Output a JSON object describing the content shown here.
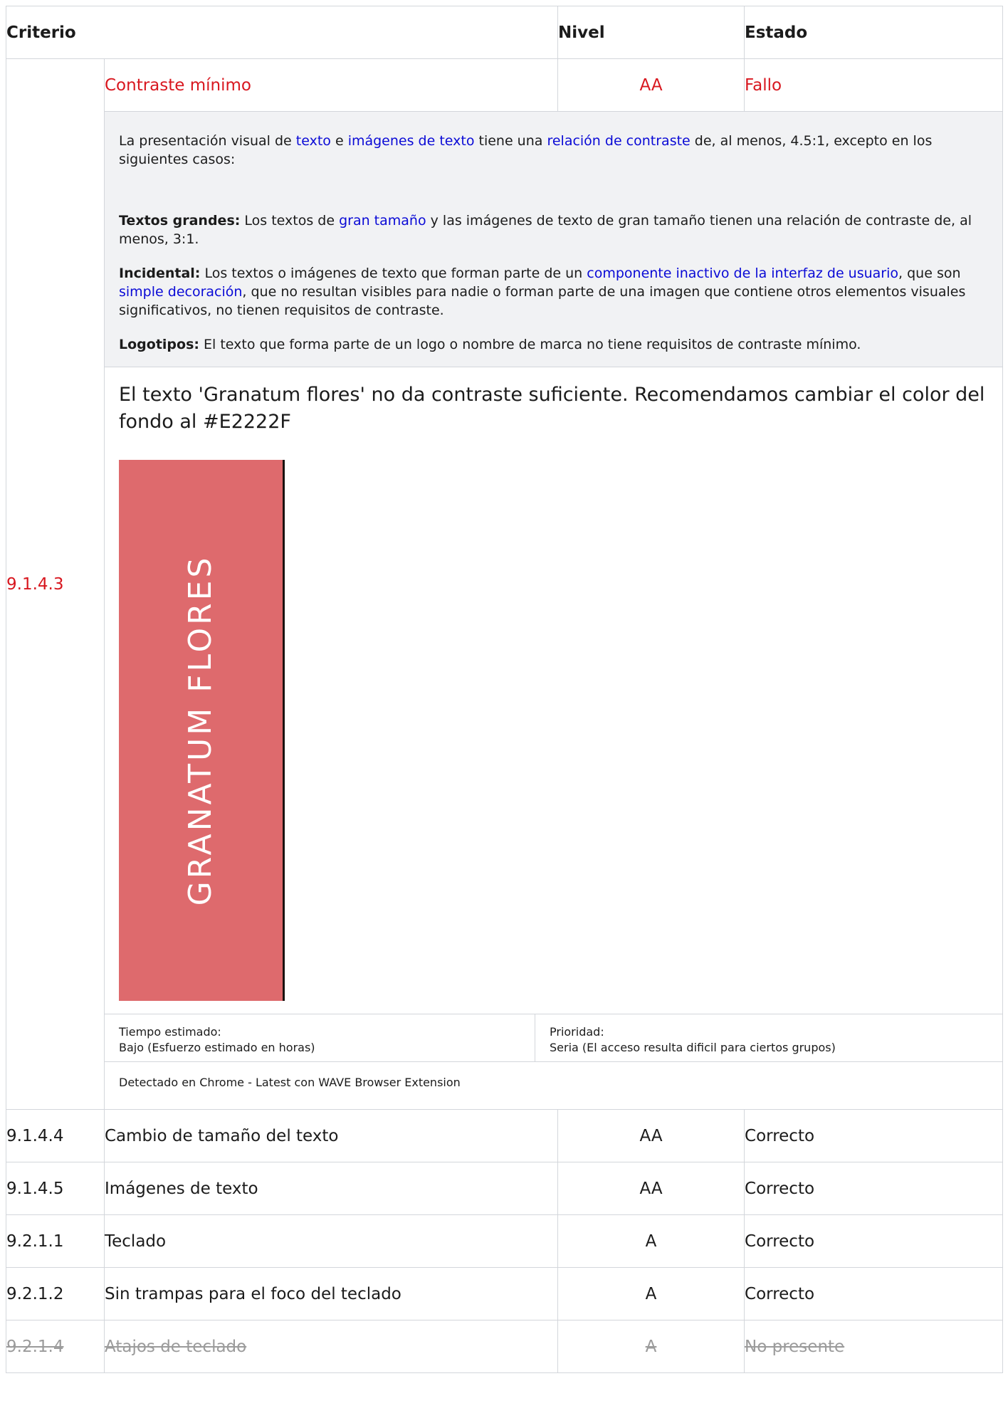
{
  "header": {
    "criterion": "Criterio",
    "level": "Nivel",
    "state": "Estado"
  },
  "failing": {
    "code": "9.1.4.3",
    "name": "Contraste mínimo",
    "level": "AA",
    "state": "Fallo",
    "description": {
      "p1_a": "La presentación visual de ",
      "p1_link1": "texto",
      "p1_b": " e ",
      "p1_link2": "imágenes de texto",
      "p1_c": " tiene una ",
      "p1_link3": "relación de contraste",
      "p1_d": " de, al menos, 4.5:1, excepto en los siguientes casos:",
      "large_label": "Textos grandes:",
      "large_a": " Los textos de ",
      "large_link": "gran tamaño",
      "large_b": " y las imágenes de texto de gran tamaño tienen una relación de contraste de, al menos, 3:1.",
      "incidental_label": "Incidental:",
      "incidental_a": " Los textos o imágenes de texto que forman parte de un ",
      "incidental_link1": "componente inactivo de la interfaz de usuario",
      "incidental_b": ", que son ",
      "incidental_link2": "simple decoración",
      "incidental_c": ", que no resultan visibles para nadie o forman parte de una imagen que contiene otros elementos visuales significativos, no tienen requisitos de contraste.",
      "logos_label": "Logotipos:",
      "logos_text": " El texto que forma parte de un logo o nombre de marca no tiene requisitos de contraste mínimo."
    },
    "finding": "El texto 'Granatum flores' no da contraste suficiente. Recomendamos cambiar el color del fondo al #E2222F",
    "sample_text": "GRANATUM FLORES",
    "sample_bg_color": "#de6a6d",
    "time_label": "Tiempo estimado:",
    "time_value": "Bajo (Esfuerzo estimado en horas)",
    "priority_label": "Prioridad:",
    "priority_value": "Seria (El acceso resulta dificil para ciertos grupos)",
    "detected": "Detectado en Chrome - Latest con WAVE Browser Extension"
  },
  "rows": [
    {
      "code": "9.1.4.4",
      "name": "Cambio de tamaño del texto",
      "level": "AA",
      "state": "Correcto"
    },
    {
      "code": "9.1.4.5",
      "name": "Imágenes de texto",
      "level": "AA",
      "state": "Correcto"
    },
    {
      "code": "9.2.1.1",
      "name": "Teclado",
      "level": "A",
      "state": "Correcto"
    },
    {
      "code": "9.2.1.2",
      "name": "Sin trampas para el foco del teclado",
      "level": "A",
      "state": "Correcto"
    },
    {
      "code": "9.2.1.4",
      "name": "Atajos de teclado",
      "level": "A",
      "state": "No presente"
    }
  ],
  "colors": {
    "fail": "#d8171f",
    "link": "#0a0ad6",
    "panel_bg": "#f1f2f4",
    "not_present": "#9b9b9b"
  }
}
